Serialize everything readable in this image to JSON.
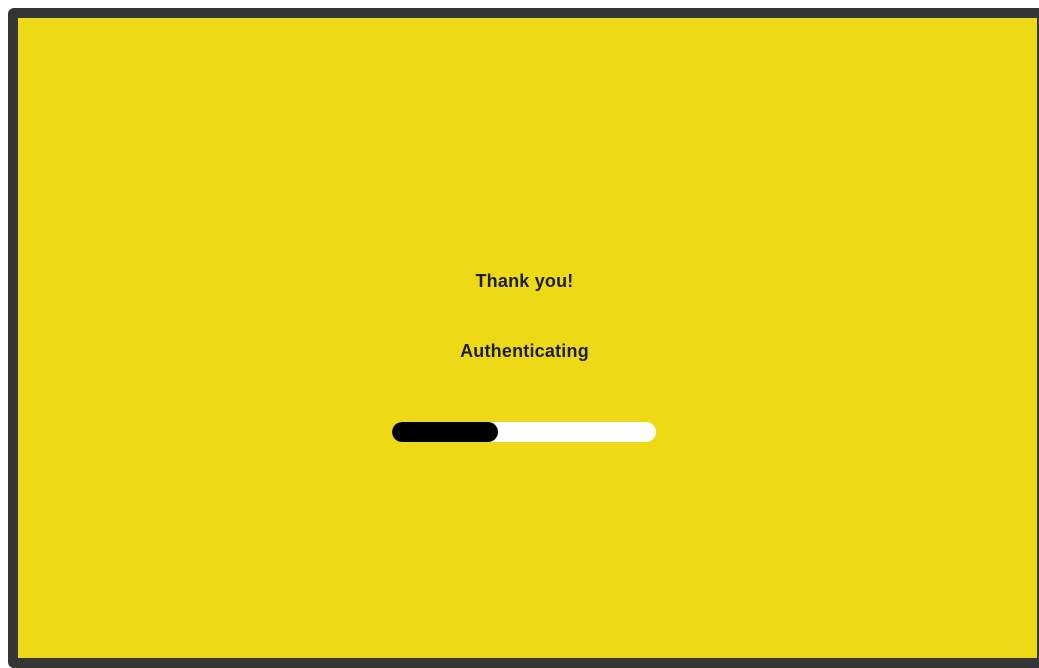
{
  "screen": {
    "background_color": "#eed916",
    "frame_color": "#353535"
  },
  "message": {
    "thanks": "Thank you!",
    "status": "Authenticating"
  },
  "progress": {
    "fraction": 0.4,
    "fill_color": "#000000",
    "track_color": "#ffffff"
  }
}
